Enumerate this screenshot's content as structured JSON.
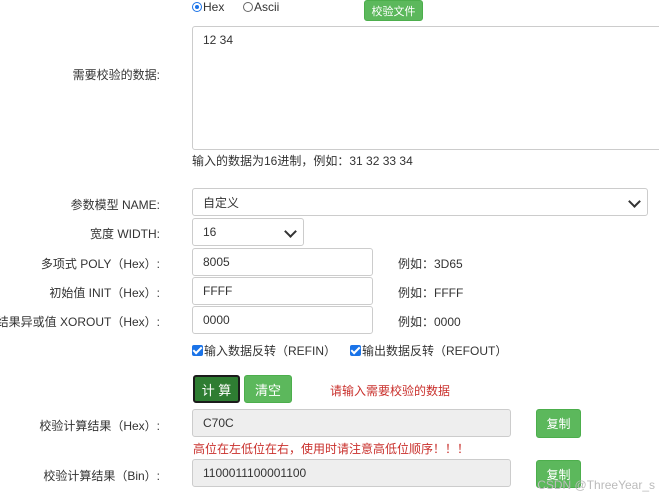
{
  "format": {
    "hex_label": "Hex",
    "ascii_label": "Ascii",
    "selected": "Hex",
    "verify_file_label": "校验文件"
  },
  "data_section": {
    "label": "需要校验的数据:",
    "value": "12 34",
    "hint": "输入的数据为16进制，例如：31 32 33 34"
  },
  "params": {
    "model_label": "参数模型 NAME:",
    "model_value": "自定义",
    "width_label": "宽度 WIDTH:",
    "width_value": "16",
    "poly_label": "多项式 POLY（Hex）:",
    "poly_value": "8005",
    "poly_example": "例如：3D65",
    "init_label": "初始值 INIT（Hex）:",
    "init_value": "FFFF",
    "init_example": "例如：FFFF",
    "xorout_label": "结果异或值 XOROUT（Hex）:",
    "xorout_value": "0000",
    "xorout_example": "例如：0000",
    "refin_label": "输入数据反转（REFIN）",
    "refout_label": "输出数据反转（REFOUT）"
  },
  "actions": {
    "calc_label": "计 算",
    "clear_label": "清空",
    "message": "请输入需要校验的数据"
  },
  "results": {
    "hex_label": "校验计算结果（Hex）:",
    "hex_value": "C70C",
    "hex_copy": "复制",
    "warning": "高位在左低位在右，使用时请注意高低位顺序！！！",
    "bin_label": "校验计算结果（Bin）:",
    "bin_value": "1100011100001100",
    "bin_copy": "复制"
  },
  "watermark": "CSDN @ThreeYear_s",
  "colors": {
    "accent_green": "#5cb85c",
    "calc_dark": "#2e7d32",
    "warning_red": "#c9302c",
    "checkbox_blue": "#1a73e8"
  }
}
